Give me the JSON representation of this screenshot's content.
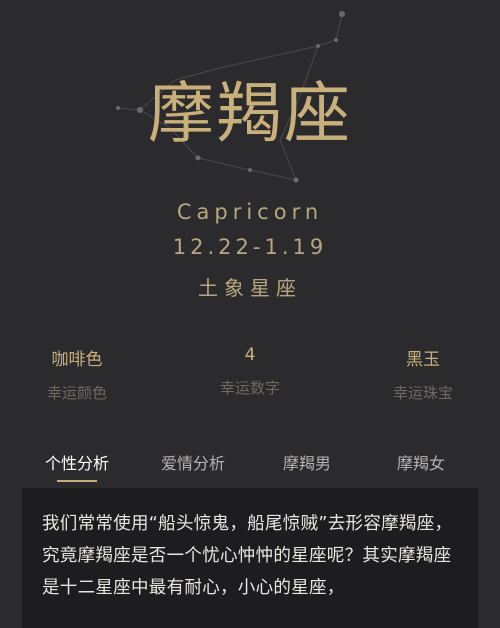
{
  "zodiac": {
    "title": "摩羯座",
    "english": "Capricorn",
    "date_range": "12.22-1.19",
    "element": "土象星座"
  },
  "lucky": [
    {
      "value": "咖啡色",
      "label": "幸运颜色"
    },
    {
      "value": "4",
      "label": "幸运数字"
    },
    {
      "value": "黑玉",
      "label": "幸运珠宝"
    }
  ],
  "tabs": [
    {
      "label": "个性分析",
      "active": true
    },
    {
      "label": "爱情分析",
      "active": false
    },
    {
      "label": "摩羯男",
      "active": false
    },
    {
      "label": "摩羯女",
      "active": false
    }
  ],
  "content": {
    "text": "我们常常使用“船头惊鬼，船尾惊贼”去形容摩羯座，究竟摩羯座是否一个忧心忡忡的星座呢？其实摩羯座是十二星座中最有耐心，小心的星座，"
  },
  "colors": {
    "background": "#2b2b2d",
    "accent_gold": "#c9b07a",
    "content_bg": "#1d1d1f"
  }
}
